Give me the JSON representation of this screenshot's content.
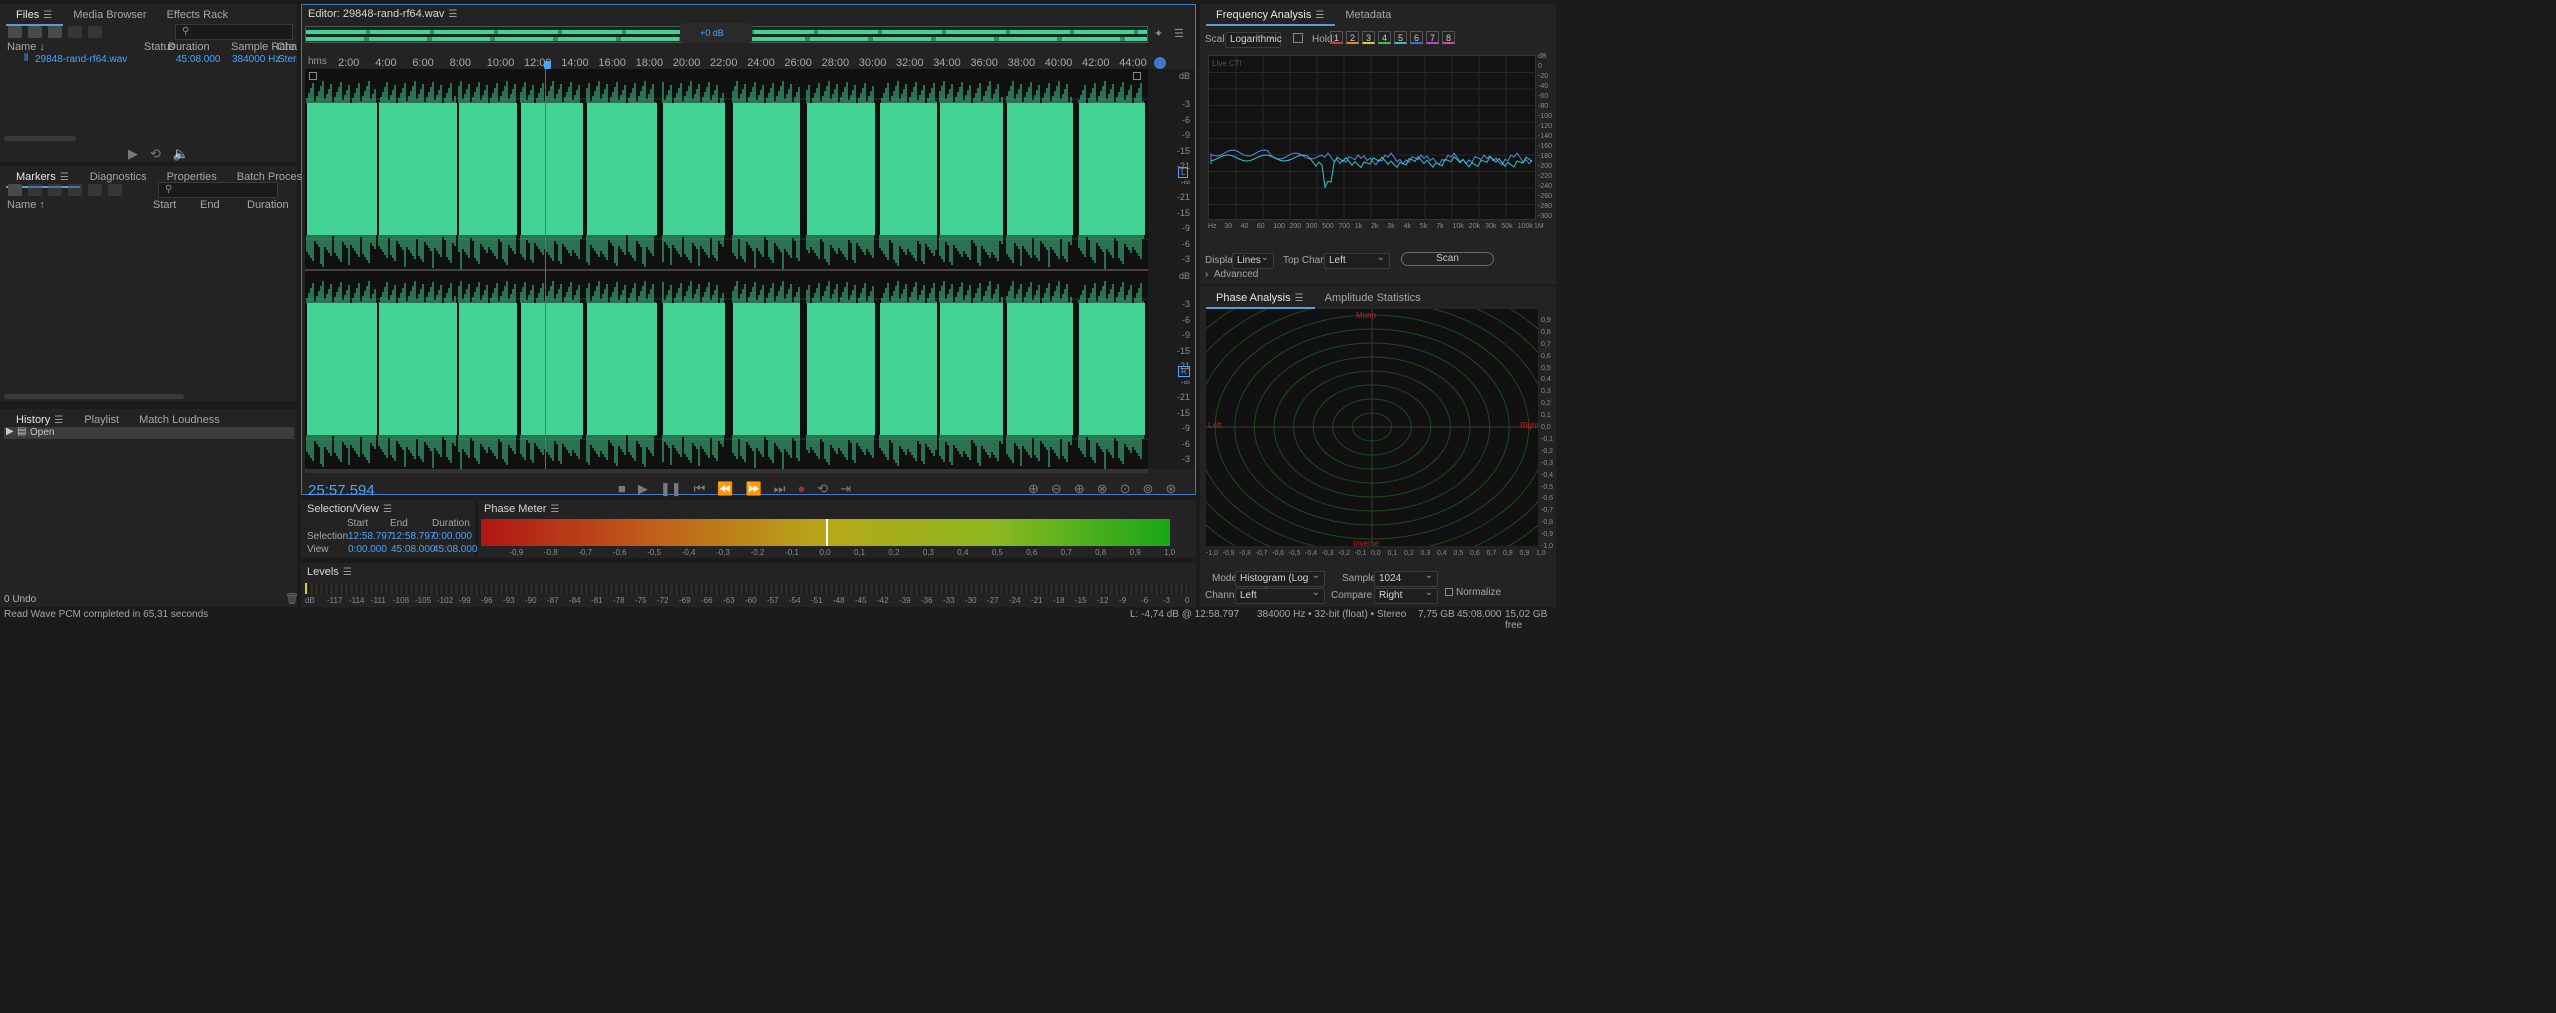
{
  "files_panel": {
    "tabs": [
      "Files",
      "Media Browser",
      "Effects Rack"
    ],
    "search_placeholder": "",
    "columns": [
      "Name",
      "Status",
      "Duration",
      "Sample Rate",
      "Chann"
    ],
    "file": {
      "name": "29848-rand-rf64.wav",
      "duration": "45:08.000",
      "sample_rate": "384000 Hz",
      "channels": "Stere"
    }
  },
  "markers_panel": {
    "tabs": [
      "Markers",
      "Diagnostics",
      "Properties",
      "Batch Process"
    ],
    "columns": [
      "Name",
      "Start",
      "End",
      "Duration"
    ]
  },
  "history_panel": {
    "tabs": [
      "History",
      "Playlist",
      "Match Loudness"
    ],
    "items": [
      "Open"
    ],
    "undo_count": "0 Undo"
  },
  "editor": {
    "title": "Editor: 29848-rand-rf64.wav",
    "gain": "+0 dB",
    "time_unit": "hms",
    "ruler": [
      "2:00",
      "4:00",
      "6:00",
      "8:00",
      "10:00",
      "12:00",
      "14:00",
      "16:00",
      "18:00",
      "20:00",
      "22:00",
      "24:00",
      "26:00",
      "28:00",
      "30:00",
      "32:00",
      "34:00",
      "36:00",
      "38:00",
      "40:00",
      "42:00",
      "44:00"
    ],
    "db_unit": "dB",
    "db_scale": [
      "-3",
      "-6",
      "-9",
      "-15",
      "-21",
      "-∞",
      "-21",
      "-15",
      "-9",
      "-6",
      "-3"
    ],
    "channel_l": "L",
    "channel_r": "R",
    "playhead_fraction": 0.285,
    "current_time": "25:57.594",
    "waveform_color": "#43d495"
  },
  "selection_view": {
    "title": "Selection/View",
    "headers": [
      "Start",
      "End",
      "Duration"
    ],
    "rows": [
      {
        "label": "Selection",
        "start": "12:58.797",
        "end": "12:58.797",
        "duration": "0:00.000"
      },
      {
        "label": "View",
        "start": "0:00.000",
        "end": "45:08.000",
        "duration": "45:08.000"
      }
    ]
  },
  "phase_meter": {
    "title": "Phase Meter",
    "ticks": [
      "-1",
      "-0,9",
      "-0,8",
      "-0,7",
      "-0,6",
      "-0,5",
      "-0,4",
      "-0,3",
      "-0,2",
      "-0,1",
      "0,0",
      "0,1",
      "0,2",
      "0,3",
      "0,4",
      "0,5",
      "0,6",
      "0,7",
      "0,8",
      "0,9",
      "1,0"
    ],
    "value": 0.0
  },
  "levels": {
    "title": "Levels",
    "ticks": [
      "dB",
      "-117",
      "-114",
      "-111",
      "-108",
      "-105",
      "-102",
      "-99",
      "-96",
      "-93",
      "-90",
      "-87",
      "-84",
      "-81",
      "-78",
      "-75",
      "-72",
      "-69",
      "-66",
      "-63",
      "-60",
      "-57",
      "-54",
      "-51",
      "-48",
      "-45",
      "-42",
      "-39",
      "-36",
      "-33",
      "-30",
      "-27",
      "-24",
      "-21",
      "-18",
      "-15",
      "-12",
      "-9",
      "-6",
      "-3",
      "0"
    ]
  },
  "freq_panel": {
    "tabs": [
      "Frequency Analysis",
      "Metadata"
    ],
    "scale_label": "Scale:",
    "scale": "Logarithmic",
    "hold_label": "Hold:",
    "hold": [
      "1",
      "2",
      "3",
      "4",
      "5",
      "6",
      "7",
      "8"
    ],
    "hold_colors": [
      "#e03030",
      "#e08a20",
      "#e0d020",
      "#40c040",
      "#30c0c0",
      "#3070e0",
      "#c040e0",
      "#e040a0"
    ],
    "live": "Live CTI",
    "db_ticks": [
      "dB",
      "0",
      "-20",
      "-40",
      "-60",
      "-80",
      "-100",
      "-120",
      "-140",
      "-160",
      "-180",
      "-200",
      "-220",
      "-240",
      "-260",
      "-280",
      "-300"
    ],
    "hz_ticks": [
      "Hz",
      "30",
      "40",
      "60",
      "100",
      "200",
      "300",
      "500",
      "700",
      "1k",
      "2k",
      "3k",
      "4k",
      "5k",
      "7k",
      "10k",
      "20k",
      "30k",
      "50k",
      "100k",
      "1M"
    ],
    "display_label": "Display:",
    "display": "Lines",
    "top_channel_label": "Top Channel:",
    "top_channel": "Left",
    "scan": "Scan",
    "advanced": "Advanced"
  },
  "phase_panel": {
    "tabs": [
      "Phase Analysis",
      "Amplitude Statistics"
    ],
    "mono": "Mono",
    "inverse": "Inverse",
    "left": "Left",
    "right": "Right",
    "y_ticks": [
      "0,9",
      "0,8",
      "0,7",
      "0,6",
      "0,5",
      "0,4",
      "0,3",
      "0,2",
      "0,1",
      "0,0",
      "-0,1",
      "-0,2",
      "-0,3",
      "-0,4",
      "-0,5",
      "-0,6",
      "-0,7",
      "-0,8",
      "-0,9",
      "-1,0"
    ],
    "x_ticks": [
      "-1,0",
      "-0,9",
      "-0,8",
      "-0,7",
      "-0,6",
      "-0,5",
      "-0,4",
      "-0,3",
      "-0,2",
      "-0,1",
      "0,0",
      "0,1",
      "0,2",
      "0,3",
      "0,4",
      "0,5",
      "0,6",
      "0,7",
      "0,8",
      "0,9",
      "1,0"
    ],
    "mode_label": "Mode:",
    "mode": "Histogram (Log Zoom)",
    "samples_label": "Samples:",
    "samples": "1024",
    "channel_label": "Channel:",
    "channel": "Left",
    "compare_label": "Compare To:",
    "compare": "Right",
    "normalize": "Normalize"
  },
  "status_bar": {
    "message": "Read Wave PCM completed in 65,31 seconds",
    "level": "L: -4,74 dB @ 12:58.797",
    "format": "384000 Hz • 32-bit (float) • Stereo",
    "size": "7,75 GB",
    "duration": "45:08.000",
    "free": "15,02 GB free"
  }
}
